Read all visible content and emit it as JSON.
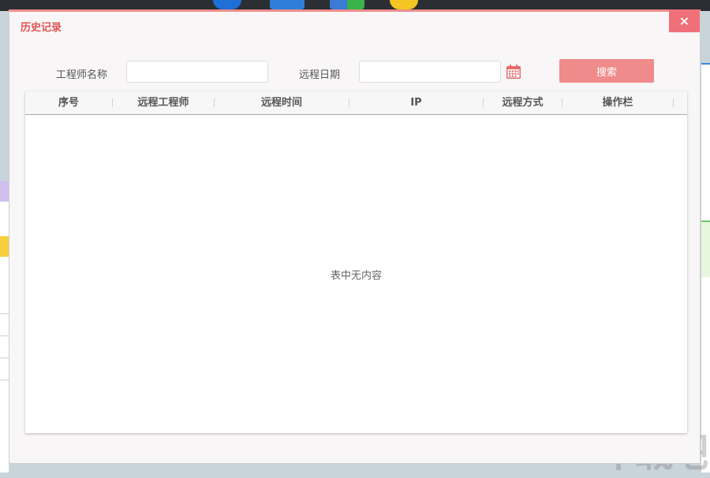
{
  "dialog": {
    "title": "历史记录",
    "close_icon": "×"
  },
  "filters": {
    "engineer_label": "工程师名称",
    "engineer_value": "",
    "date_label": "远程日期",
    "date_value": "",
    "calendar_icon": "calendar-icon",
    "search_label": "搜索"
  },
  "table": {
    "columns": [
      "序号",
      "远程工程师",
      "远程时间",
      "IP",
      "远程方式",
      "操作栏"
    ],
    "rows": [],
    "empty_text": "表中无内容"
  },
  "colors": {
    "accent": "#f08b8b",
    "title": "#e05555",
    "close": "#f0707a"
  }
}
